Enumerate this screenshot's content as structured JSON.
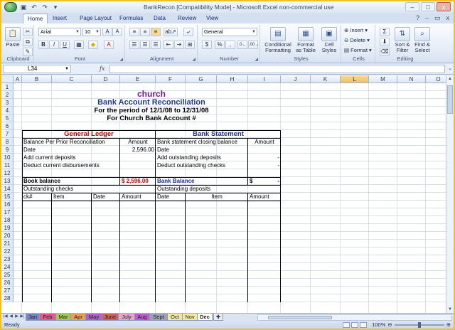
{
  "window": {
    "title": "BankRecon  [Compatibility Mode]  -  Microsoft Excel non-commercial use",
    "minimize": "–",
    "maximize": "□",
    "close": "x"
  },
  "ribbon_tabs": [
    "Home",
    "Insert",
    "Page Layout",
    "Formulas",
    "Data",
    "Review",
    "View"
  ],
  "ribbon": {
    "clipboard": {
      "label": "Clipboard",
      "paste": "Paste"
    },
    "font": {
      "label": "Font",
      "name": "Arial",
      "size": "10"
    },
    "alignment": {
      "label": "Alignment"
    },
    "number": {
      "label": "Number",
      "format": "General",
      "currency": "$",
      "percent": "%",
      "comma": ","
    },
    "styles": {
      "label": "Styles",
      "conditional": "Conditional Formatting",
      "format_table": "Format as Table",
      "cell_styles": "Cell Styles"
    },
    "cells": {
      "label": "Cells",
      "insert": "Insert",
      "delete": "Delete",
      "format": "Format"
    },
    "editing": {
      "label": "Editing",
      "sort": "Sort & Filter",
      "find": "Find & Select"
    }
  },
  "formula_bar": {
    "name_box": "L34",
    "fx": "fx",
    "value": ""
  },
  "columns": [
    "A",
    "B",
    "C",
    "D",
    "E",
    "F",
    "G",
    "H",
    "I",
    "J",
    "K",
    "L",
    "M",
    "N",
    "O"
  ],
  "selected_column": "L",
  "rows": [
    "1",
    "2",
    "3",
    "4",
    "5",
    "6",
    "7",
    "8",
    "9",
    "10",
    "11",
    "12",
    "13",
    "14",
    "15",
    "16",
    "17",
    "18",
    "19",
    "20",
    "21",
    "22",
    "23",
    "24",
    "25",
    "26",
    "27",
    "28"
  ],
  "sheet": {
    "church": "church",
    "heading": "Bank Account Reconciliation",
    "period": "For the period of 12/1/08 to 12/31/08",
    "account": "For Church Bank Account #",
    "general_ledger": "General Ledger",
    "bank_statement": "Bank Statement",
    "gl_balance_label": "Balance Per Prior Reconciliation",
    "gl_amount_header": "Amount",
    "gl_date": "Date",
    "gl_balance_value": "2,596.00",
    "gl_add": "Add current deposits",
    "gl_deduct": "Deduct current disbursements",
    "book_balance": "Book balance",
    "book_balance_value": "$  2,596.00",
    "bs_closing": "Bank statement closing balance",
    "bs_amount_header": "Amount",
    "bs_date": "Date",
    "bs_add": "Add outstanding deposits",
    "bs_deduct": "Deduct outstanding checks",
    "bs_add_value": "-",
    "bs_deduct_value": "-",
    "bank_balance": "Bank Balance",
    "bank_balance_currency": "$",
    "bank_balance_value": "-",
    "outstanding_checks": "Outstanding checks",
    "outstanding_deposits": "Outstanding deposits",
    "oc_headers": [
      "ck#",
      "Item",
      "Date",
      "Amount"
    ],
    "od_headers": [
      "Date",
      "Item",
      "Amount"
    ]
  },
  "sheet_tabs": [
    {
      "label": "Jan",
      "color": "#7b86c7"
    },
    {
      "label": "Feb",
      "color": "#e05a8a"
    },
    {
      "label": "Mar",
      "color": "#a6c74c"
    },
    {
      "label": "Apr",
      "color": "#e8a050"
    },
    {
      "label": "May",
      "color": "#b061c9"
    },
    {
      "label": "June",
      "color": "#d45d5d"
    },
    {
      "label": "July",
      "color": "#e6a4c9"
    },
    {
      "label": "Aug",
      "color": "#c25bd1"
    },
    {
      "label": "Sept",
      "color": "#9ca2b1"
    },
    {
      "label": "Oct",
      "color": "#f2e6a7"
    },
    {
      "label": "Nov",
      "color": "#f3ea9b"
    },
    {
      "label": "Dec",
      "color": "#ffffff"
    }
  ],
  "status": {
    "ready": "Ready",
    "zoom": "100%"
  },
  "colors": {
    "title_purple": "#6b1e8c",
    "heading_blue": "#1f3c8c",
    "red": "#c00000",
    "navy": "#1f2d8a"
  }
}
